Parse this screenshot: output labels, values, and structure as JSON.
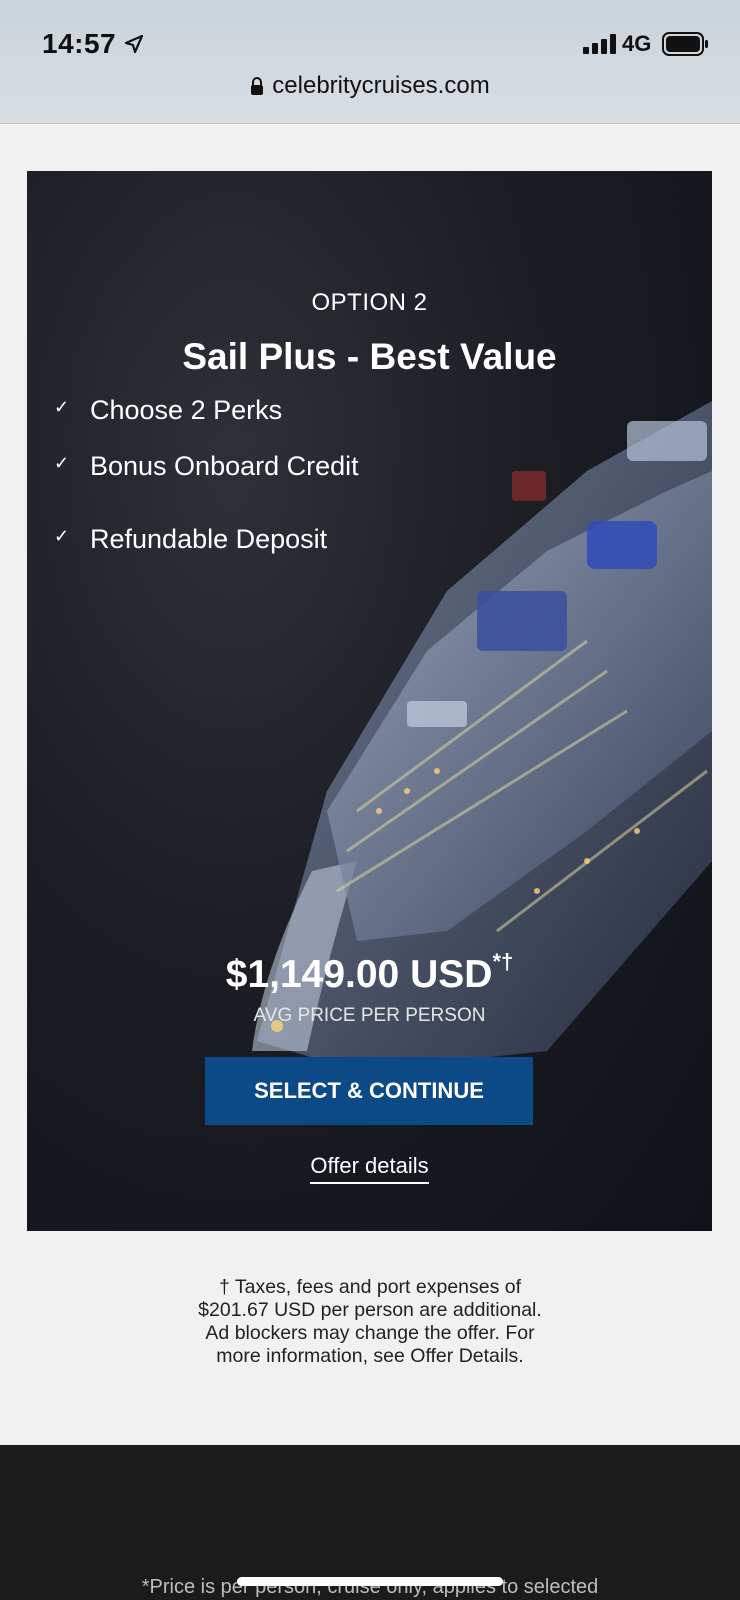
{
  "status_bar": {
    "time": "14:57",
    "network": "4G",
    "icons": [
      "location-arrow-icon",
      "signal-icon",
      "battery-icon"
    ]
  },
  "browser": {
    "url": "celebritycruises.com",
    "icon": "lock-icon"
  },
  "offer": {
    "option_label": "OPTION 2",
    "title": "Sail Plus - Best Value",
    "perks": [
      "Choose 2 Perks",
      "Bonus Onboard Credit",
      "Refundable Deposit"
    ],
    "check_glyph": "✓",
    "price": "$1,149.00 USD",
    "price_marks": "*†",
    "price_caption": "AVG PRICE PER PERSON",
    "select_button": "SELECT & CONTINUE",
    "offer_details_link": "Offer details",
    "button_color": "#0b4a86"
  },
  "disclaimer": "† Taxes, fees and port expenses of $201.67 USD per person are additional. Ad blockers may change the offer. For more information, see Offer Details.",
  "footer": {
    "text": "*Price is per person, cruise only, applies to selected"
  }
}
